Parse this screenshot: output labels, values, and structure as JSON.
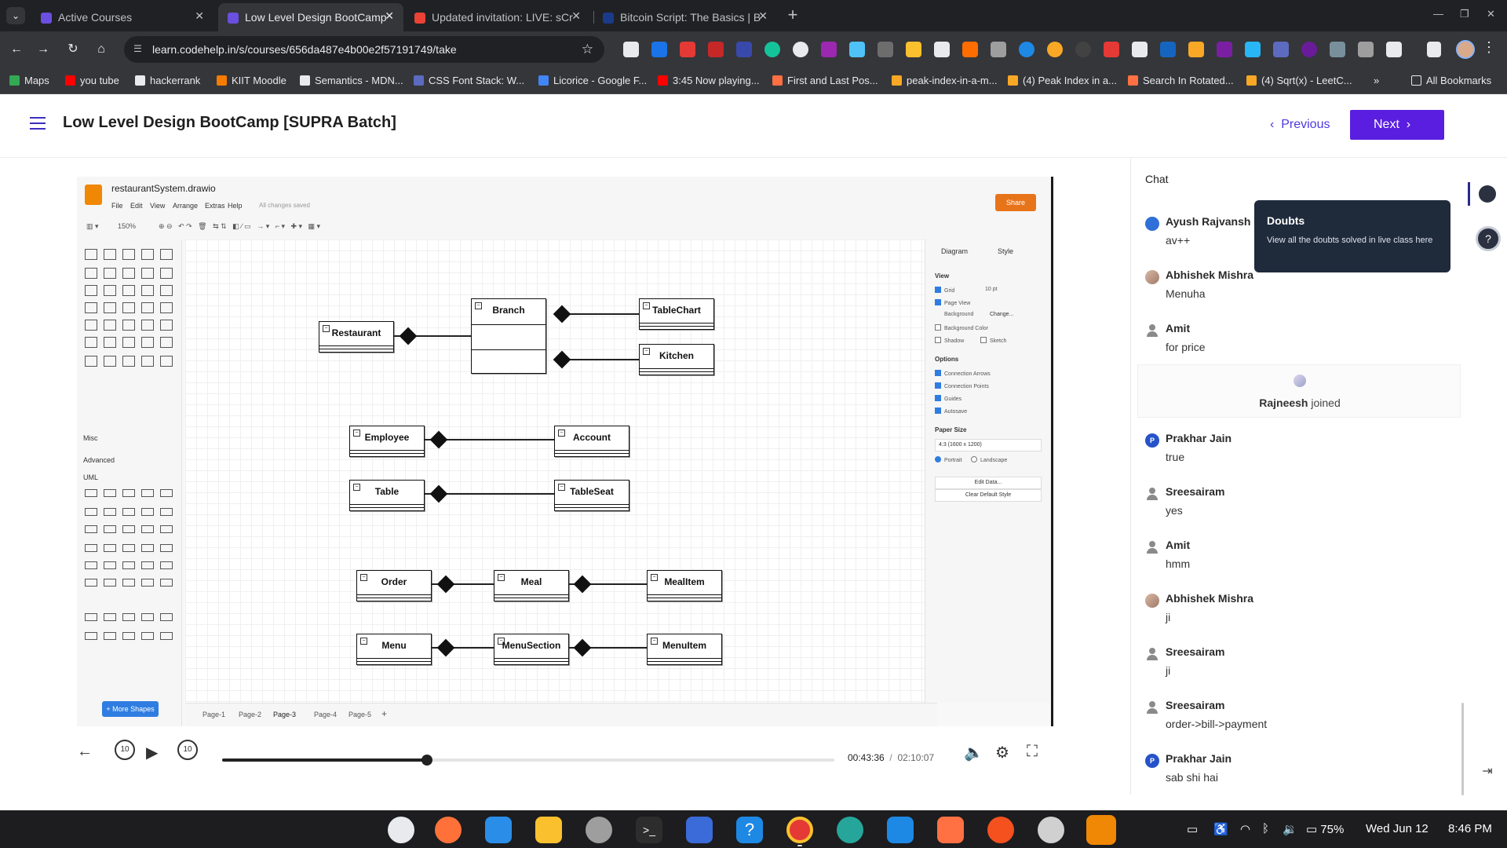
{
  "browser": {
    "tabs": [
      {
        "title": "Active Courses",
        "active": false
      },
      {
        "title": "Low Level Design BootCamp",
        "active": true
      },
      {
        "title": "Updated invitation: LIVE: sCr",
        "active": false
      },
      {
        "title": "Bitcoin Script: The Basics | B",
        "active": false
      }
    ],
    "url": "learn.codehelp.in/s/courses/656da487e4b00e2f57191749/take",
    "bookmarks": [
      "Maps",
      "you tube",
      "hackerrank",
      "KIIT Moodle",
      "Semantics - MDN...",
      "CSS Font Stack: W...",
      "Licorice - Google F...",
      "3:45 Now playing...",
      "First and Last Pos...",
      "peak-index-in-a-m...",
      "(4) Peak Index in a...",
      "Search In Rotated...",
      "(4) Sqrt(x) - LeetC..."
    ],
    "all_bookmarks": "All Bookmarks",
    "more_bookmarks": "»"
  },
  "header": {
    "course_title": "Low Level Design BootCamp [SUPRA Batch]",
    "previous_label": "Previous",
    "next_label": "Next"
  },
  "drawio": {
    "file_name": "restaurantSystem.drawio",
    "menus": [
      "File",
      "Edit",
      "View",
      "Arrange",
      "Extras",
      "Help"
    ],
    "save_status": "All changes saved",
    "share_label": "Share",
    "zoom": "150%",
    "sections": [
      "Misc",
      "Advanced",
      "UML"
    ],
    "more_shapes": "+ More Shapes",
    "pages": [
      "Page-1",
      "Page-2",
      "Page-3",
      "Page-4",
      "Page-5"
    ],
    "active_page": "Page-3",
    "format": {
      "tabs": [
        "Diagram",
        "Style"
      ],
      "view_heading": "View",
      "view_items": [
        {
          "label": "Grid",
          "checked": true
        },
        {
          "label": "Page View",
          "checked": true
        },
        {
          "label": "Background",
          "checked": false
        },
        {
          "label": "Background Color",
          "checked": false
        },
        {
          "label": "Shadow",
          "checked": false
        },
        {
          "label": "Sketch",
          "checked": false
        }
      ],
      "grid_size": "10 pt",
      "change_label": "Change...",
      "options_heading": "Options",
      "options": [
        "Connection Arrows",
        "Connection Points",
        "Guides",
        "Autosave"
      ],
      "paper_heading": "Paper Size",
      "paper_value": "4:3 (1600 x 1200)",
      "portrait": "Portrait",
      "landscape": "Landscape",
      "edit_data": "Edit Data...",
      "clear_style": "Clear Default Style"
    },
    "classes": {
      "restaurant": "Restaurant",
      "branch": "Branch",
      "tablechart": "TableChart",
      "kitchen": "Kitchen",
      "employee": "Employee",
      "account": "Account",
      "table": "Table",
      "tableseat": "TableSeat",
      "order": "Order",
      "meal": "Meal",
      "mealitem": "MealItem",
      "menu": "Menu",
      "menusection": "MenuSection",
      "menuitem": "MenuItem"
    }
  },
  "player": {
    "current_time": "00:43:36",
    "separator": "/",
    "total_time": "02:10:07",
    "progress": 0.335,
    "skip_seconds": "10"
  },
  "chat": {
    "title": "Chat",
    "messages": [
      {
        "name": "Ayush Rajvansh",
        "text": "av++",
        "avatar": "logo"
      },
      {
        "name": "Abhishek Mishra",
        "text": "Menuha",
        "avatar": "photo"
      },
      {
        "name": "Amit",
        "text": "for price",
        "avatar": "person"
      },
      {
        "name": "Prakhar Jain",
        "text": "true",
        "avatar": "P"
      },
      {
        "name": "Sreesairam",
        "text": "yes",
        "avatar": "person"
      },
      {
        "name": "Amit",
        "text": "hmm",
        "avatar": "person"
      },
      {
        "name": "Abhishek Mishra",
        "text": "ji",
        "avatar": "photo"
      },
      {
        "name": "Sreesairam",
        "text": "ji",
        "avatar": "person"
      },
      {
        "name": "Sreesairam",
        "text": "order->bill->payment",
        "avatar": "person"
      },
      {
        "name": "Prakhar Jain",
        "text": "sab shi hai",
        "avatar": "P"
      }
    ],
    "joined_name": "Rajneesh",
    "joined_text": "joined",
    "tooltip_title": "Doubts",
    "tooltip_body": "View all the doubts solved in live class here"
  },
  "taskbar": {
    "battery": "75%",
    "date": "Wed Jun 12",
    "time": "8:46 PM"
  }
}
